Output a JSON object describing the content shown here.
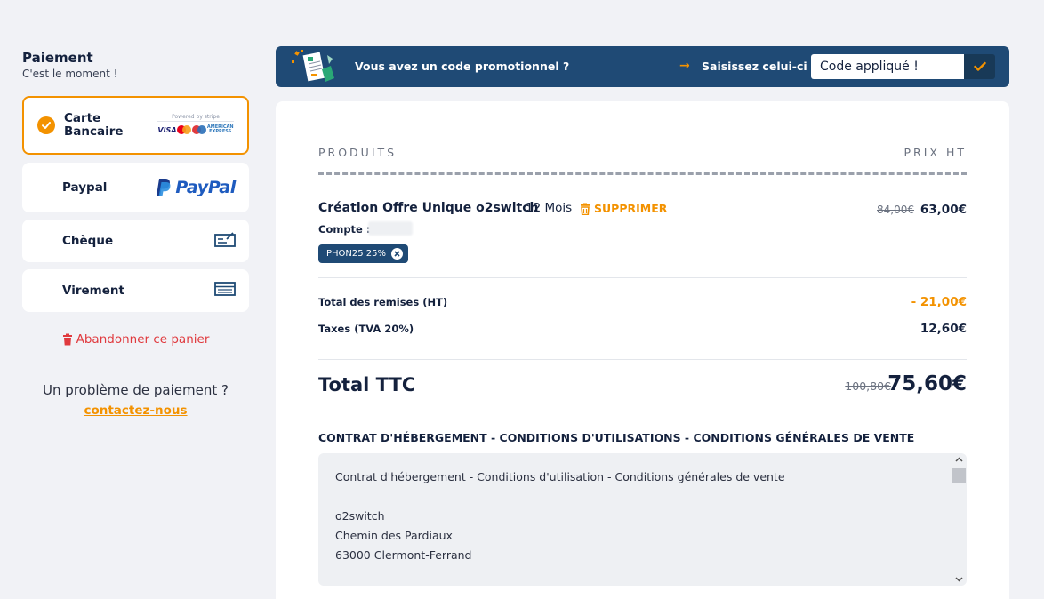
{
  "sidebar": {
    "title": "Paiement",
    "subtitle": "C'est le moment !",
    "methods": [
      {
        "label_line1": "Carte",
        "label_line2": "Bancaire",
        "selected": true
      },
      {
        "label": "Paypal",
        "logo_text": "PayPal"
      },
      {
        "label": "Chèque"
      },
      {
        "label": "Virement"
      }
    ],
    "stripe": {
      "powered_by": "Powered by stripe",
      "visa": "VISA",
      "amex_line1": "AMERICAN",
      "amex_line2": "EXPRESS"
    },
    "abandon_label": "Abandonner ce panier",
    "problem_text": "Un problème de paiement ?",
    "contact_label": "contactez-nous"
  },
  "promo": {
    "question": "Vous avez un code promotionnel ?",
    "enter_label": "Saisissez celui-ci",
    "input_placeholder": "Code appliqué !",
    "arrow": "→"
  },
  "cart": {
    "col_products": "PRODUITS",
    "col_price": "PRIX HT",
    "product": {
      "name": "Création Offre Unique o2switch",
      "duration": "12 Mois",
      "delete_label": "SUPPRIMER",
      "old_price": "84,00€",
      "price": "63,00€",
      "account_label": "Compte :",
      "coupon": "IPHON25 25%"
    },
    "discounts_label": "Total des remises (HT)",
    "discounts_value": "- 21,00€",
    "taxes_label": "Taxes (TVA 20%)",
    "taxes_value": "12,60€",
    "total_label": "Total TTC",
    "total_old": "100,80€",
    "total_value": "75,60€",
    "contract_title": "CONTRAT D'HÉBERGEMENT - CONDITIONS D'UTILISATIONS - CONDITIONS GÉNÉRALES DE VENTE",
    "contract_lines": {
      "l1": "Contrat d'hébergement - Conditions d'utilisation - Conditions générales de vente",
      "l2": "o2switch",
      "l3": "Chemin des Pardiaux",
      "l4": "63000 Clermont-Ferrand"
    }
  },
  "colors": {
    "accent": "#f39200",
    "navy": "#1f4a75",
    "danger": "#e03a3e",
    "text": "#14213d"
  }
}
